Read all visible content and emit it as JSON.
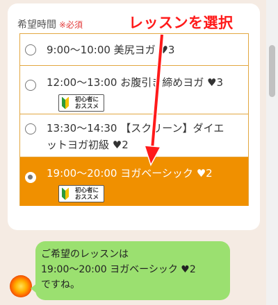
{
  "form": {
    "field_label": "希望時間",
    "required_label": "※必須",
    "options": [
      {
        "label": "9:00〜10:00 美尻ヨガ ♥3",
        "selected": false,
        "badge": null
      },
      {
        "label": "12:00〜13:00 お腹引き締めヨガ ♥3",
        "selected": false,
        "badge": {
          "line1": "初心者に",
          "line2": "おススメ"
        }
      },
      {
        "label_line1": "13:30〜14:30 【スクリーン】ダイエ",
        "label_line2": "ットヨガ初級 ♥2",
        "selected": false,
        "badge": null
      },
      {
        "label": "19:00〜20:00 ヨガベーシック ♥2",
        "selected": true,
        "badge": {
          "line1": "初心者に",
          "line2": "おススメ"
        }
      }
    ]
  },
  "annotation": {
    "text": "レッスンを選択",
    "color": "#ff1a1a"
  },
  "chat": {
    "lines": [
      "ご希望のレッスンは",
      "19:00〜20:00 ヨガベーシック ♥2",
      "ですね。"
    ]
  },
  "colors": {
    "background": "#f5ebe3",
    "accent": "#f09000",
    "option_border": "#e2a640",
    "bubble": "#9be070",
    "required": "#e23a3a"
  },
  "icons": {
    "beginner_mark": "beginner-leaf-icon",
    "avatar": "sun-avatar-icon"
  }
}
